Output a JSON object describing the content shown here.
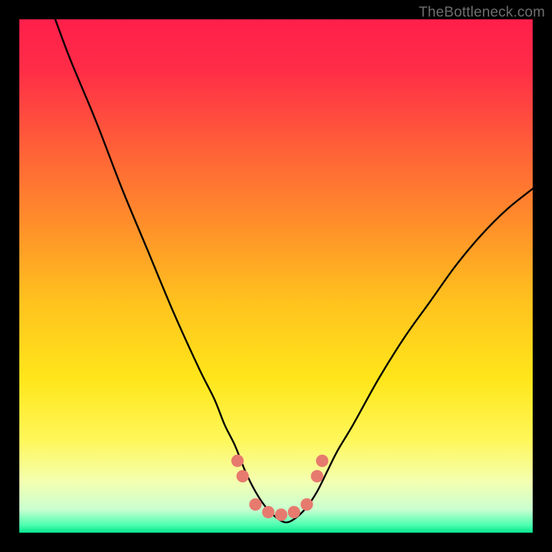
{
  "watermark": "TheBottleneck.com",
  "chart_data": {
    "type": "line",
    "title": "",
    "xlabel": "",
    "ylabel": "",
    "xlim": [
      0,
      100
    ],
    "ylim": [
      0,
      100
    ],
    "series": [
      {
        "name": "bottleneck-curve",
        "x": [
          7,
          10,
          15,
          20,
          25,
          30,
          35,
          38,
          40,
          42,
          44,
          46,
          48,
          50,
          52,
          54,
          56,
          58,
          60,
          62,
          65,
          70,
          75,
          80,
          85,
          90,
          95,
          100
        ],
        "values": [
          100,
          92,
          80,
          67,
          55,
          43,
          32,
          26,
          21,
          17,
          12,
          8,
          5,
          3,
          2,
          3,
          5,
          8,
          12,
          16,
          21,
          30,
          38,
          45,
          52,
          58,
          63,
          67
        ]
      }
    ],
    "markers": {
      "name": "highlight-dots",
      "x": [
        42.5,
        43.5,
        46,
        48.5,
        51,
        53.5,
        56,
        58,
        59
      ],
      "values": [
        14,
        11,
        5.5,
        4,
        3.5,
        4,
        5.5,
        11,
        14
      ],
      "color": "#e77a6e",
      "radius": 9
    },
    "background_gradient_stops": [
      {
        "offset": 0.0,
        "color": "#ff1f4b"
      },
      {
        "offset": 0.1,
        "color": "#ff2d47"
      },
      {
        "offset": 0.25,
        "color": "#ff6038"
      },
      {
        "offset": 0.4,
        "color": "#ff8f2a"
      },
      {
        "offset": 0.55,
        "color": "#ffc21e"
      },
      {
        "offset": 0.7,
        "color": "#ffe61a"
      },
      {
        "offset": 0.82,
        "color": "#fff75a"
      },
      {
        "offset": 0.9,
        "color": "#f4ffb0"
      },
      {
        "offset": 0.955,
        "color": "#c9ffd0"
      },
      {
        "offset": 0.985,
        "color": "#4dffb0"
      },
      {
        "offset": 1.0,
        "color": "#06e58f"
      }
    ]
  }
}
